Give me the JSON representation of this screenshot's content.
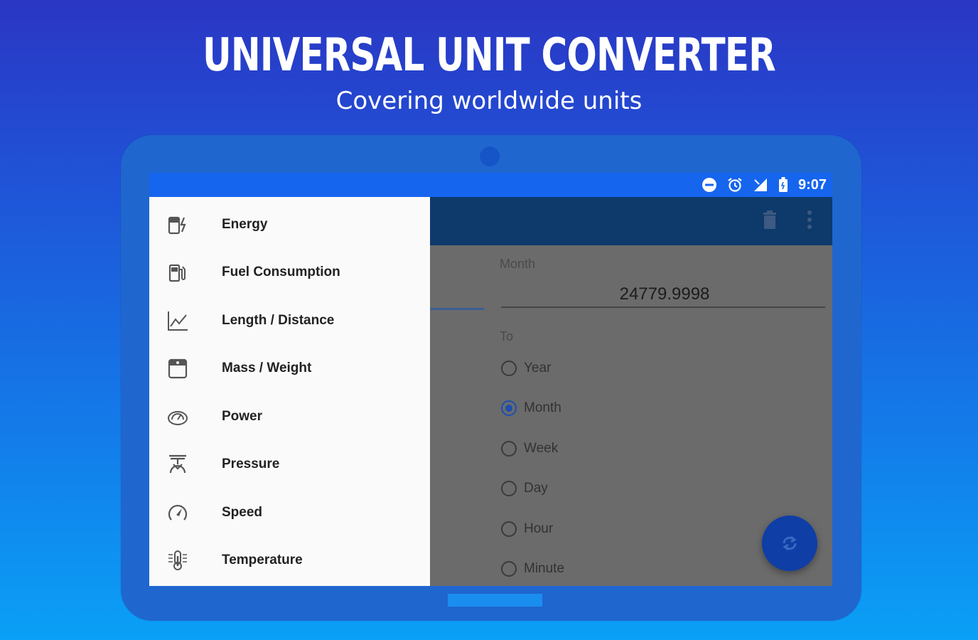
{
  "promo": {
    "title": "UNIVERSAL UNIT CONVERTER",
    "subtitle": "Covering worldwide units"
  },
  "status_bar": {
    "time": "9:07",
    "icons": [
      "do-not-disturb-icon",
      "alarm-icon",
      "signal-icon",
      "battery-icon"
    ]
  },
  "drawer": {
    "items": [
      {
        "label": "Energy",
        "icon": "energy-icon"
      },
      {
        "label": "Fuel Consumption",
        "icon": "fuel-pump-icon"
      },
      {
        "label": "Length / Distance",
        "icon": "line-chart-icon"
      },
      {
        "label": "Mass / Weight",
        "icon": "scale-icon"
      },
      {
        "label": "Power",
        "icon": "gauge-icon"
      },
      {
        "label": "Pressure",
        "icon": "pressure-icon"
      },
      {
        "label": "Speed",
        "icon": "speedometer-icon"
      },
      {
        "label": "Temperature",
        "icon": "thermometer-icon"
      }
    ]
  },
  "converter": {
    "from_label": "Month",
    "from_value": "24779.9998",
    "to_label": "To",
    "options": [
      {
        "label": "Year",
        "checked": false
      },
      {
        "label": "Month",
        "checked": true
      },
      {
        "label": "Week",
        "checked": false
      },
      {
        "label": "Day",
        "checked": false
      },
      {
        "label": "Hour",
        "checked": false
      },
      {
        "label": "Minute",
        "checked": false
      }
    ]
  },
  "toolbar": {
    "icons": [
      "trash-icon",
      "more-vert-icon"
    ]
  },
  "fab": {
    "icon": "swap-icon"
  },
  "colors": {
    "status_bar": "#1665ee",
    "app_bar": "#0e3a6b",
    "fab": "#0e3ea6",
    "accent": "#1c4fae"
  }
}
